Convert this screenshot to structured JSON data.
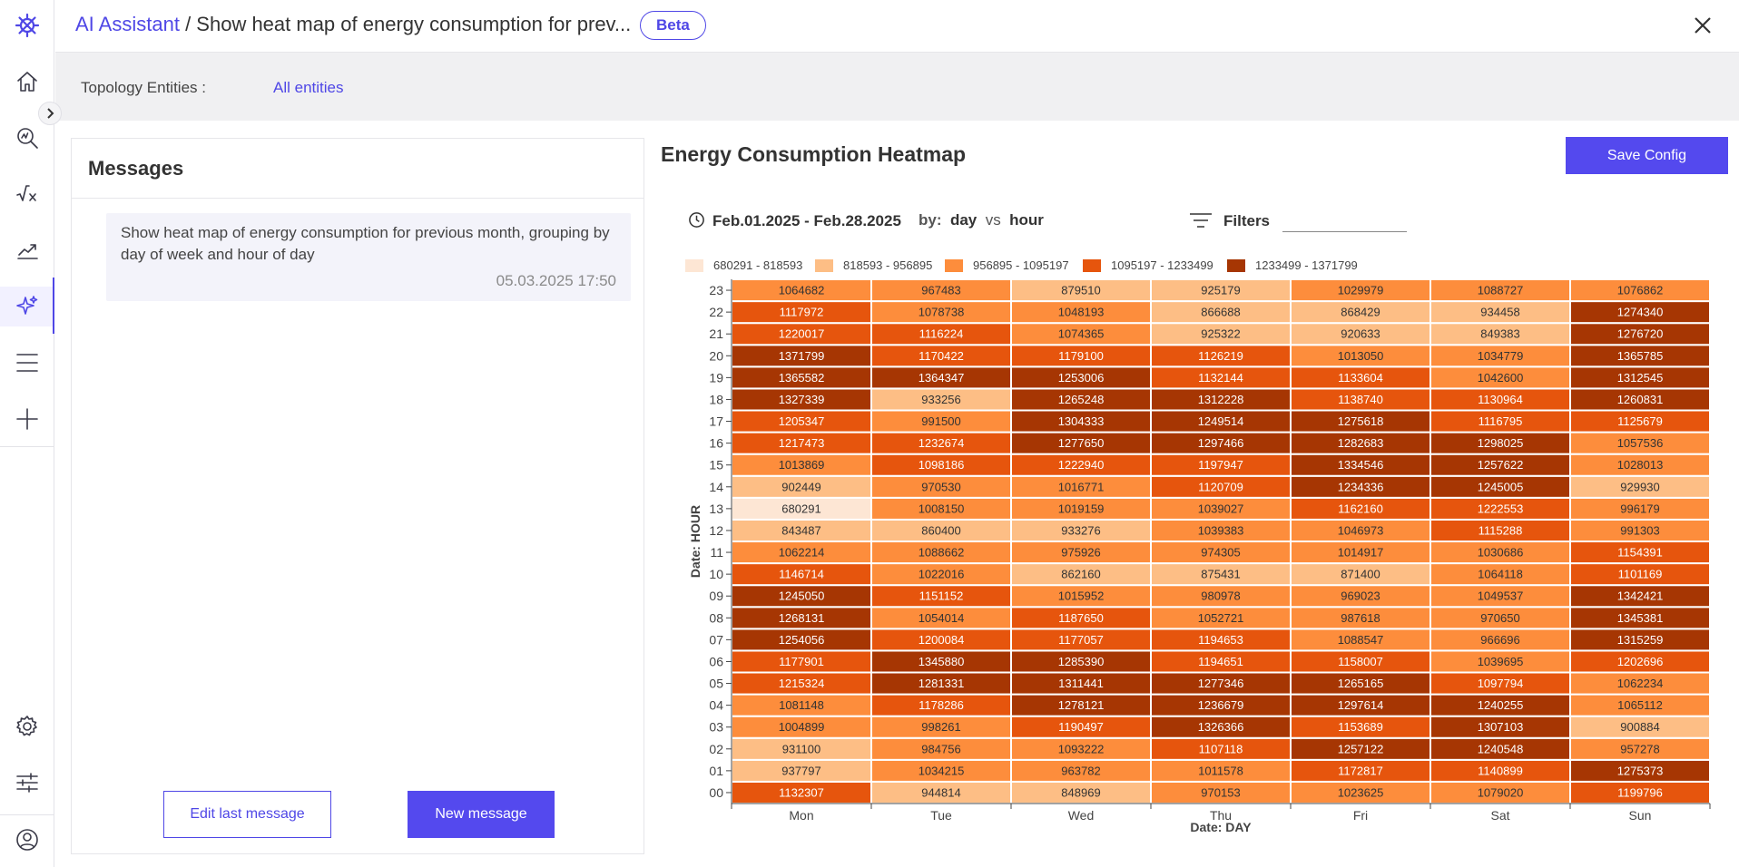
{
  "breadcrumb": {
    "root": "AI Assistant",
    "separator": " / ",
    "current": "Show heat map of energy consumption for prev..."
  },
  "badge": "Beta",
  "topology": {
    "label": "Topology Entities :",
    "value": "All entities"
  },
  "messages": {
    "title": "Messages",
    "items": [
      {
        "text": "Show heat map of energy consumption for previous month, grouping by day of week and hour of day",
        "time": "05.03.2025 17:50"
      }
    ],
    "edit_label": "Edit last message",
    "new_label": "New message"
  },
  "heatmap": {
    "title": "Energy Consumption Heatmap",
    "save_label": "Save Config",
    "date_range": "Feb.01.2025 - Feb.28.2025",
    "by_label": "by:",
    "by_x": "day",
    "vs_label": "vs",
    "by_y": "hour",
    "filters_label": "Filters"
  },
  "chart_data": {
    "type": "heatmap",
    "xlabel": "Date: DAY",
    "ylabel": "Date: HOUR",
    "x": [
      "Mon",
      "Tue",
      "Wed",
      "Thu",
      "Fri",
      "Sat",
      "Sun"
    ],
    "y": [
      "00",
      "01",
      "02",
      "03",
      "04",
      "05",
      "06",
      "07",
      "08",
      "09",
      "10",
      "11",
      "12",
      "13",
      "14",
      "15",
      "16",
      "17",
      "18",
      "19",
      "20",
      "21",
      "22",
      "23"
    ],
    "legend": [
      {
        "label": "680291 - 818593",
        "min": 680291,
        "max": 818593,
        "color": "#fde6d4"
      },
      {
        "label": "818593 - 956895",
        "min": 818593,
        "max": 956895,
        "color": "#fdbe85"
      },
      {
        "label": "956895 - 1095197",
        "min": 956895,
        "max": 1095197,
        "color": "#fd8d3c"
      },
      {
        "label": "1095197 - 1233499",
        "min": 1095197,
        "max": 1233499,
        "color": "#e6550d"
      },
      {
        "label": "1233499 - 1371799",
        "min": 1233499,
        "max": 1371799,
        "color": "#a63603"
      }
    ],
    "values": [
      [
        1132307,
        944814,
        848969,
        970153,
        1023625,
        1079020,
        1199796
      ],
      [
        937797,
        1034215,
        963782,
        1011578,
        1172817,
        1140899,
        1275373
      ],
      [
        931100,
        984756,
        1093222,
        1107118,
        1257122,
        1240548,
        957278
      ],
      [
        1004899,
        998261,
        1190497,
        1326366,
        1153689,
        1307103,
        900884
      ],
      [
        1081148,
        1178286,
        1278121,
        1236679,
        1297614,
        1240255,
        1065112
      ],
      [
        1215324,
        1281331,
        1311441,
        1277346,
        1265165,
        1097794,
        1062234
      ],
      [
        1177901,
        1345880,
        1285390,
        1194651,
        1158007,
        1039695,
        1202696
      ],
      [
        1254056,
        1200084,
        1177057,
        1194653,
        1088547,
        966696,
        1315259
      ],
      [
        1268131,
        1054014,
        1187650,
        1052721,
        987618,
        970650,
        1345381
      ],
      [
        1245050,
        1151152,
        1015952,
        980978,
        969023,
        1049537,
        1342421
      ],
      [
        1146714,
        1022016,
        862160,
        875431,
        871400,
        1064118,
        1101169
      ],
      [
        1062214,
        1088662,
        975926,
        974305,
        1014917,
        1030686,
        1154391
      ],
      [
        843487,
        860400,
        933276,
        1039383,
        1046973,
        1115288,
        991303
      ],
      [
        680291,
        1008150,
        1019159,
        1039027,
        1162160,
        1222553,
        996179
      ],
      [
        902449,
        970530,
        1016771,
        1120709,
        1234336,
        1245005,
        929930
      ],
      [
        1013869,
        1098186,
        1222940,
        1197947,
        1334546,
        1257622,
        1028013
      ],
      [
        1217473,
        1232674,
        1277650,
        1297466,
        1282683,
        1298025,
        1057536
      ],
      [
        1205347,
        991500,
        1304333,
        1249514,
        1275618,
        1116795,
        1125679
      ],
      [
        1327339,
        933256,
        1265248,
        1312228,
        1138740,
        1130964,
        1260831
      ],
      [
        1365582,
        1364347,
        1253006,
        1132144,
        1133604,
        1042600,
        1312545
      ],
      [
        1371799,
        1170422,
        1179100,
        1126219,
        1013050,
        1034779,
        1365785
      ],
      [
        1220017,
        1116224,
        1074365,
        925322,
        920633,
        849383,
        1276720
      ],
      [
        1117972,
        1078738,
        1048193,
        866688,
        868429,
        934458,
        1274340
      ],
      [
        1064682,
        967483,
        879510,
        925179,
        1029979,
        1088727,
        1076862
      ]
    ]
  }
}
